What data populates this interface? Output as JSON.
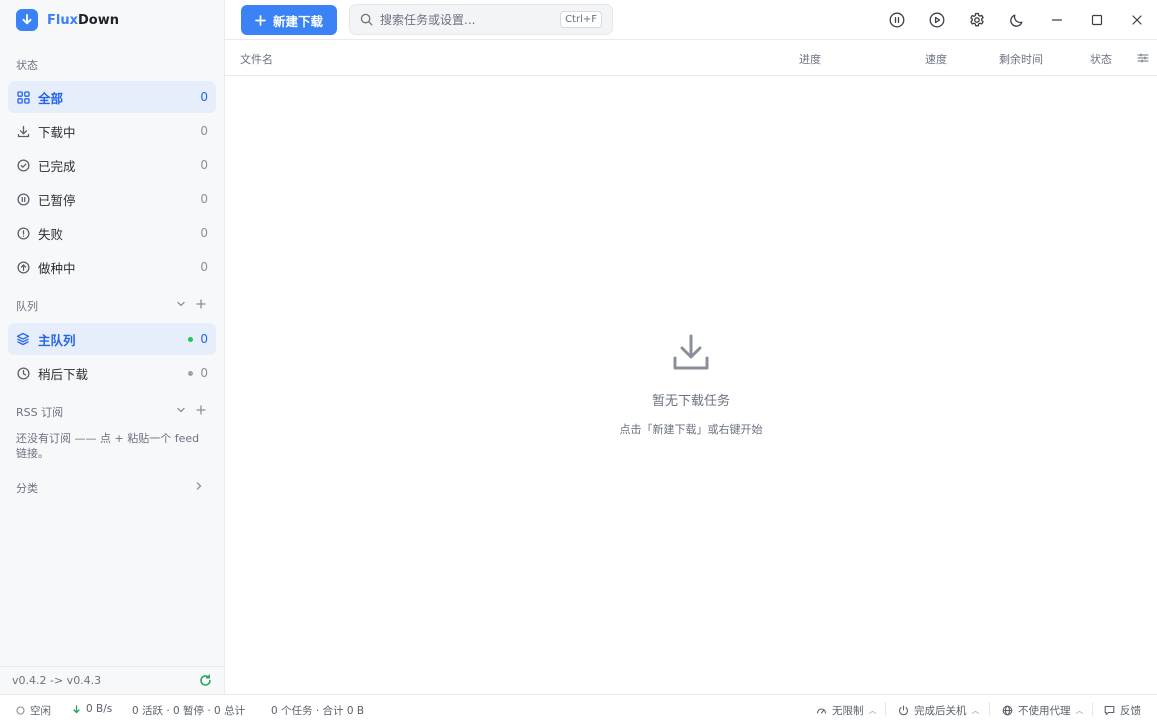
{
  "app": {
    "name_prefix": "Flux",
    "name_suffix": "Down"
  },
  "colors": {
    "accent": "#3b82f6",
    "active_bg": "#e6eefc",
    "online_dot": "#22c55e",
    "idle_dot": "#9ca3af",
    "update_icon": "#22a35a"
  },
  "sidebar": {
    "status_title": "状态",
    "status_items": [
      {
        "label": "全部",
        "count": "0",
        "icon": "grid-icon"
      },
      {
        "label": "下载中",
        "count": "0",
        "icon": "download-icon"
      },
      {
        "label": "已完成",
        "count": "0",
        "icon": "check-circle-icon"
      },
      {
        "label": "已暂停",
        "count": "0",
        "icon": "pause-circle-icon"
      },
      {
        "label": "失败",
        "count": "0",
        "icon": "alert-circle-icon"
      },
      {
        "label": "做种中",
        "count": "0",
        "icon": "upload-circle-icon"
      }
    ],
    "queue_title": "队列",
    "queue_items": [
      {
        "label": "主队列",
        "count": "0",
        "icon": "layers-icon"
      },
      {
        "label": "稍后下载",
        "count": "0",
        "icon": "clock-icon"
      }
    ],
    "rss_title": "RSS 订阅",
    "rss_empty": "还没有订阅 —— 点 + 粘贴一个 feed 链接。",
    "category_title": "分类",
    "version": "v0.4.2 -> v0.4.3"
  },
  "toolbar": {
    "new_download": "新建下载",
    "search_placeholder": "搜索任务或设置...",
    "search_shortcut": "Ctrl+F"
  },
  "table": {
    "columns": {
      "filename": "文件名",
      "progress": "进度",
      "speed": "速度",
      "remaining": "剩余时间",
      "status": "状态"
    }
  },
  "empty_state": {
    "title": "暂无下载任务",
    "subtitle": "点击「新建下载」或右键开始"
  },
  "statusbar": {
    "state": "空闲",
    "speed": "0 B/s",
    "counts": "0 活跃 · 0 暂停 · 0 总计",
    "tasks": "0 个任务 · 合计 0 B",
    "speed_limit": "无限制",
    "after_complete": "完成后关机",
    "proxy": "不使用代理",
    "feedback": "反馈"
  }
}
